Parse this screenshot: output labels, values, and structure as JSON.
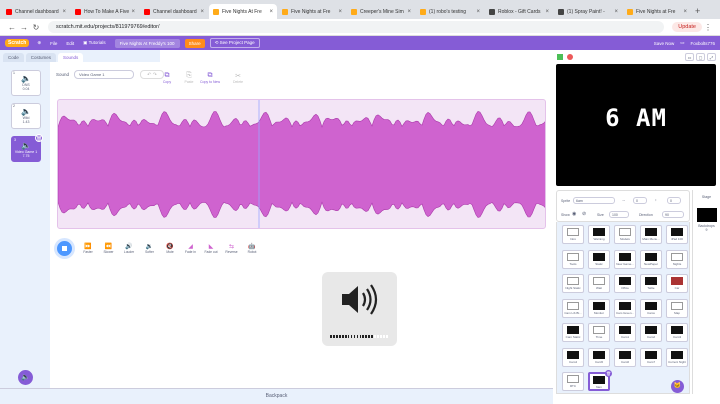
{
  "browser": {
    "tabs": [
      {
        "label": "Channel dashboard",
        "color": "#ff0000"
      },
      {
        "label": "How To Make A Five",
        "color": "#ff0000"
      },
      {
        "label": "Channel dashboard",
        "color": "#ff0000"
      },
      {
        "label": "Five Nights At Fre",
        "color": "#ffab19",
        "active": true
      },
      {
        "label": "Five Nights at Fre",
        "color": "#ffab19"
      },
      {
        "label": "Creeper's Mine Sim",
        "color": "#ffab19"
      },
      {
        "label": "(1) robo's testing",
        "color": "#ffab19"
      },
      {
        "label": "Roblox - Gift Cards",
        "color": "#444444"
      },
      {
        "label": "(1) Spray Paint! -",
        "color": "#444444"
      },
      {
        "label": "Five Nights at Fre",
        "color": "#ffab19"
      }
    ],
    "url": "scratch.mit.edu/projects/811979769/editor/",
    "update_label": "Update"
  },
  "menubar": {
    "logo": "Scratch",
    "file": "File",
    "edit": "Edit",
    "tutorials": "Tutorials",
    "project_title": "Five Nights At Freddy's 100",
    "share": "Share",
    "see_project": "See Project Page",
    "save_now": "Save Now",
    "user": "Foxbolts776"
  },
  "editor_tabs": {
    "code": "Code",
    "costumes": "Costumes",
    "sounds": "Sounds"
  },
  "sounds": [
    {
      "num": "1",
      "name": "DNS",
      "dur": "0.04"
    },
    {
      "num": "2",
      "name": "Wild",
      "dur": "1.43"
    },
    {
      "num": "3",
      "name": "Video Game 1",
      "dur": "7.75"
    }
  ],
  "sound_editor": {
    "sound_label": "Sound",
    "sound_name": "Video Game 1",
    "tools": [
      "Copy",
      "Paste",
      "Copy to New",
      "Delete"
    ],
    "effects": [
      "Faster",
      "Slower",
      "Louder",
      "Softer",
      "Mute",
      "Fade in",
      "Fade out",
      "Reverse",
      "Robot"
    ]
  },
  "stage": {
    "display_text": "6 AM"
  },
  "sprite_info": {
    "sprite_label": "Sprite",
    "sprite_name": "6am",
    "x": "0",
    "y": "0",
    "show_label": "Show",
    "size_label": "Size",
    "size": "100",
    "direction_label": "Direction",
    "direction": "90"
  },
  "sprites": [
    "Intro",
    "Warning",
    "Models",
    "Main Menu...",
    "iPad 100",
    "Tools",
    "Static",
    "New Game...",
    "NewPaper",
    "Nights",
    "Night Static",
    "Wait",
    "Office",
    "Table",
    "Car",
    "Cam Lib Bt...",
    "Monitor",
    "Cam Green...",
    "Cams",
    "Map",
    "Cam Static",
    "Time",
    "Cam1",
    "Cam2",
    "Cam3",
    "Cam4",
    "Cam5",
    "Cam6",
    "Cam7",
    "Current Night",
    "RTC",
    "6am"
  ],
  "stage_panel": {
    "label": "Stage",
    "backdrops_label": "Backdrops",
    "backdrops_count": "9"
  },
  "backpack": "Backpack",
  "volume": {
    "level": 0.75
  },
  "colors": {
    "accent": "#855cd6",
    "wave": "#cf63cf",
    "play": "#4c97ff"
  }
}
